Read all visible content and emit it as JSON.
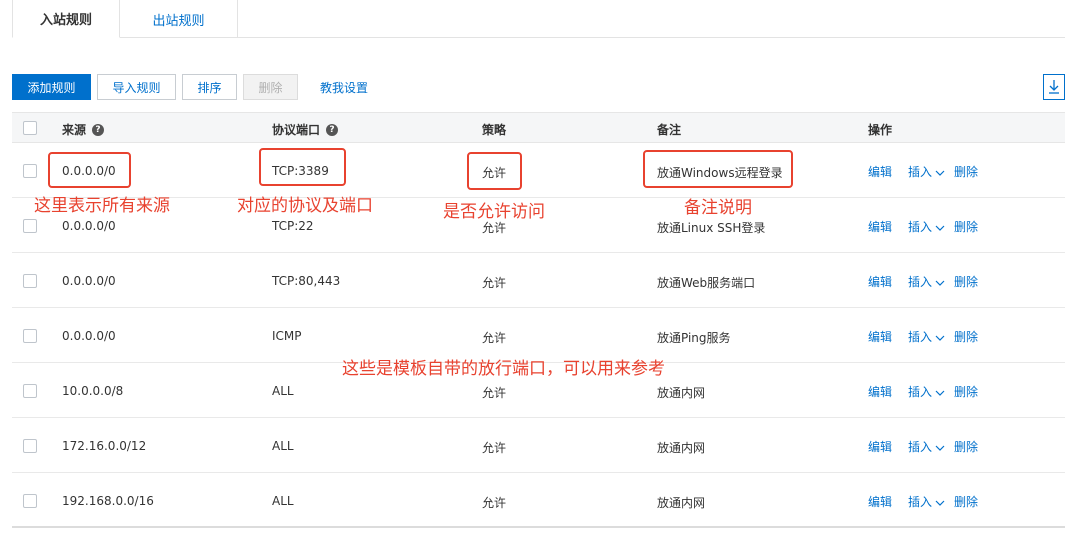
{
  "tabs": {
    "inbound": "入站规则",
    "outbound": "出站规则"
  },
  "toolbar": {
    "add": "添加规则",
    "import": "导入规则",
    "sort": "排序",
    "delete": "删除",
    "help": "教我设置"
  },
  "table": {
    "headers": {
      "source": "来源",
      "port": "协议端口",
      "policy": "策略",
      "note": "备注",
      "action": "操作"
    },
    "rows": [
      {
        "source": "0.0.0.0/0",
        "port": "TCP:3389",
        "policy": "允许",
        "note": "放通Windows远程登录"
      },
      {
        "source": "0.0.0.0/0",
        "port": "TCP:22",
        "policy": "允许",
        "note": "放通Linux SSH登录"
      },
      {
        "source": "0.0.0.0/0",
        "port": "TCP:80,443",
        "policy": "允许",
        "note": "放通Web服务端口"
      },
      {
        "source": "0.0.0.0/0",
        "port": "ICMP",
        "policy": "允许",
        "note": "放通Ping服务"
      },
      {
        "source": "10.0.0.0/8",
        "port": "ALL",
        "policy": "允许",
        "note": "放通内网"
      },
      {
        "source": "172.16.0.0/12",
        "port": "ALL",
        "policy": "允许",
        "note": "放通内网"
      },
      {
        "source": "192.168.0.0/16",
        "port": "ALL",
        "policy": "允许",
        "note": "放通内网"
      }
    ],
    "actions": {
      "edit": "编辑",
      "insert": "插入",
      "delete": "删除"
    }
  },
  "annotations": {
    "source": "这里表示所有来源",
    "port": "对应的协议及端口",
    "policy": "是否允许访问",
    "note": "备注说明",
    "template": "这些是模板自带的放行端口，可以用来参考"
  },
  "colors": {
    "accent": "#0070cc",
    "annotation": "#e8422f"
  },
  "icons": {
    "download": "download-icon",
    "help": "question-icon",
    "chevron": "chevron-down-icon"
  }
}
